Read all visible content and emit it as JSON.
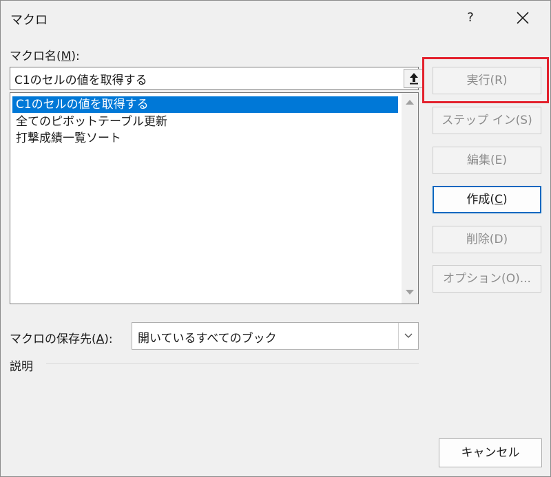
{
  "window": {
    "title": "マクロ",
    "help_label": "?",
    "close_icon": "close-icon"
  },
  "macro_name": {
    "label_prefix": "マクロ名(",
    "label_key": "M",
    "label_suffix": "):",
    "value": "C1のセルの値を取得する",
    "upload_icon": "upload-arrow-icon"
  },
  "macro_list": {
    "items": [
      {
        "label": "C1のセルの値を取得する",
        "selected": true
      },
      {
        "label": "全てのピボットテーブル更新",
        "selected": false
      },
      {
        "label": "打撃成績一覧ソート",
        "selected": false
      }
    ]
  },
  "location": {
    "label_prefix": "マクロの保存先(",
    "label_key": "A",
    "label_suffix": "):",
    "value": "開いているすべてのブック"
  },
  "description": {
    "label": "説明"
  },
  "buttons": {
    "run": "実行(R)",
    "step_in": "ステップ イン(S)",
    "edit": "編集(E)",
    "create_prefix": "作成(",
    "create_key": "C",
    "create_suffix": ")",
    "delete": "削除(D)",
    "options": "オプション(O)...",
    "cancel": "キャンセル"
  },
  "colors": {
    "selection": "#0078d7",
    "highlight": "#e3202c",
    "default_button_border": "#0067c0"
  }
}
